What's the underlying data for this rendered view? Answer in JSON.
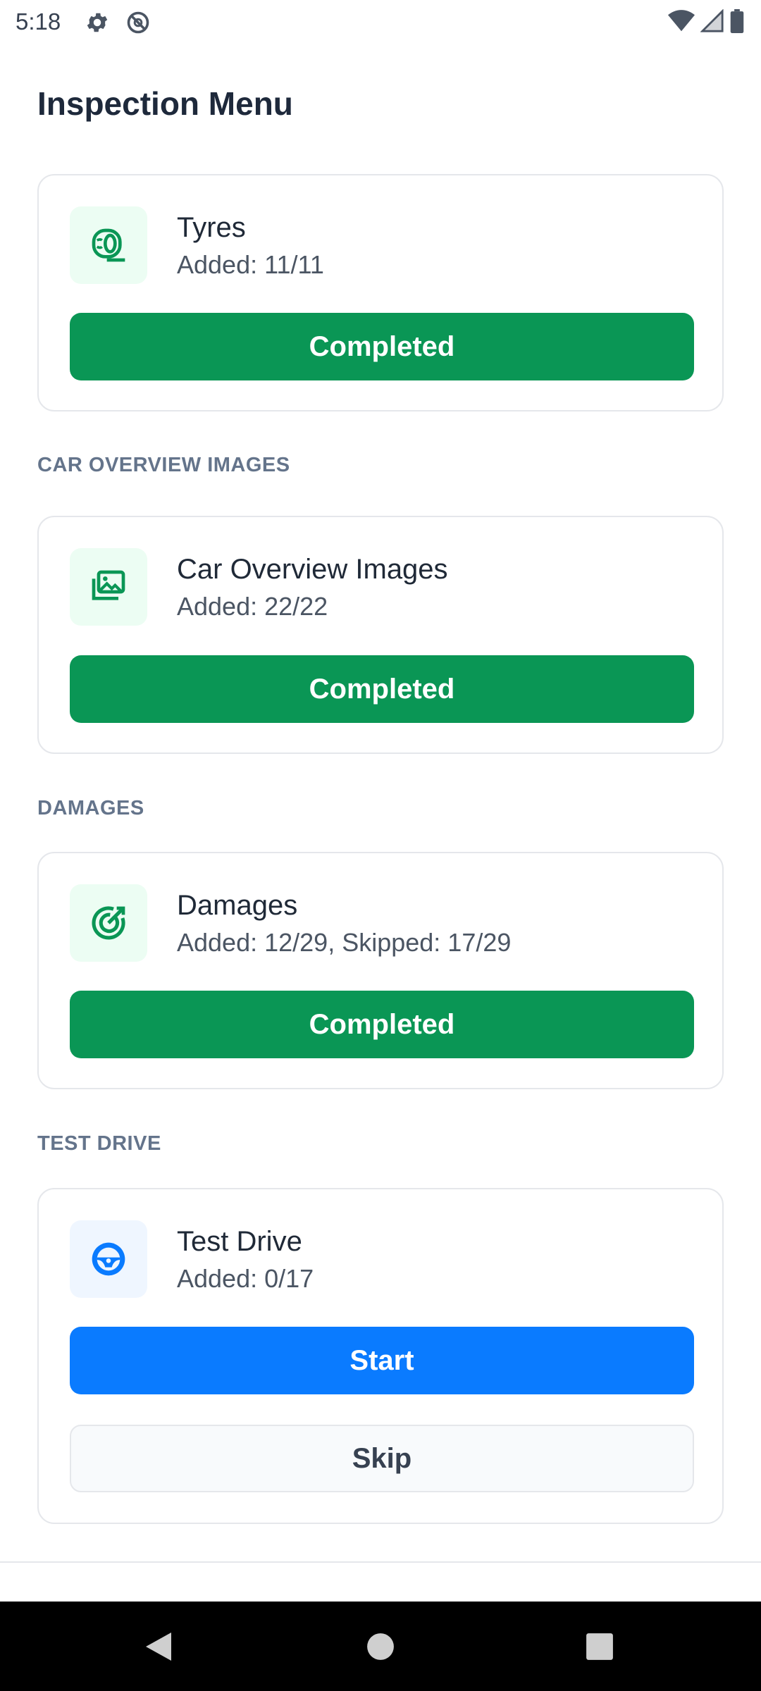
{
  "status_bar": {
    "time": "5:18",
    "left_icons": [
      "gear-icon",
      "do-not-disturb-icon"
    ],
    "right_icons": [
      "wifi-icon",
      "signal-icon",
      "battery-icon"
    ]
  },
  "page": {
    "title": "Inspection Menu"
  },
  "colors": {
    "completed": "#0a9655",
    "start": "#0a7bff",
    "section_label": "#64748b",
    "icon_green": "#0a9655",
    "icon_blue": "#0a7bff"
  },
  "cards": [
    {
      "id": "tyres",
      "section": "",
      "icon": "tyre-icon",
      "title": "Tyres",
      "subtitle": "Added: 11/11",
      "button": "Completed"
    },
    {
      "id": "car-overview-images",
      "section": "CAR OVERVIEW IMAGES",
      "icon": "images-icon",
      "title": "Car Overview Images",
      "subtitle": "Added: 22/22",
      "button": "Completed"
    },
    {
      "id": "damages",
      "section": "DAMAGES",
      "icon": "damage-target-icon",
      "title": "Damages",
      "subtitle": "Added: 12/29, Skipped: 17/29",
      "button": "Completed"
    },
    {
      "id": "test-drive",
      "section": "TEST DRIVE",
      "icon": "steering-wheel-icon",
      "title": "Test Drive",
      "subtitle": "Added: 0/17",
      "button": "Start",
      "secondary_button": "Skip"
    }
  ],
  "nav_bar": {
    "buttons": [
      "back-icon",
      "home-icon",
      "recents-icon"
    ]
  }
}
